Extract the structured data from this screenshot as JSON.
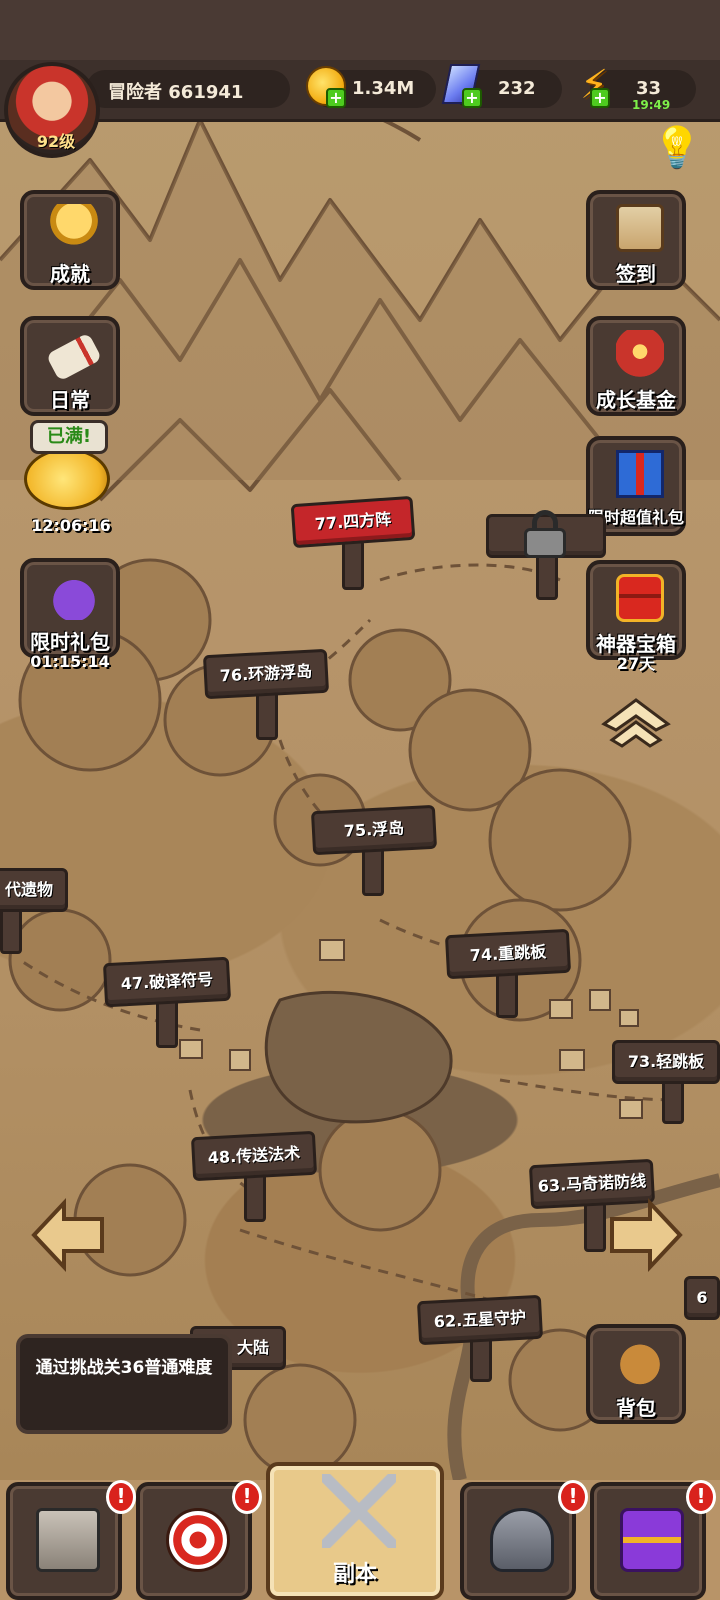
{
  "header": {
    "player_name": "冒险者 661941",
    "level": "92级",
    "gold": "1.34M",
    "gems": "232",
    "energy": "33",
    "energy_timer": "19:49"
  },
  "left_buttons": {
    "achievements": "成就",
    "daily": "日常",
    "piggy_bubble": "已满!",
    "piggy_timer": "12:06:16",
    "limited_pack": "限时礼包",
    "limited_pack_timer": "01:15:14"
  },
  "right_buttons": {
    "sign_in": "签到",
    "growth_fund": "成长基金",
    "value_pack": "限时超值礼包",
    "artifact_chest": "神器宝箱",
    "artifact_days": "27天",
    "backpack": "背包"
  },
  "stages": {
    "s77": "77.四方阵",
    "s76": "76.环游浮岛",
    "s75": "75.浮岛",
    "s74": "74.重跳板",
    "s73": "73.轻跳板",
    "s47": "47.破译符号",
    "s48": "48.传送法术",
    "s63": "63.马奇诺防线",
    "s62": "62.五星守护",
    "relic": "代遗物",
    "continent": "大陆",
    "edge": "6"
  },
  "quest": {
    "text": "通过挑战关36普通难度"
  },
  "bottom_nav": {
    "dungeon_label": "副本",
    "alert_symbol": "!"
  },
  "colors": {
    "accent_red": "#c4262a",
    "parchment": "#b6946a",
    "wood": "#4d3b33"
  }
}
